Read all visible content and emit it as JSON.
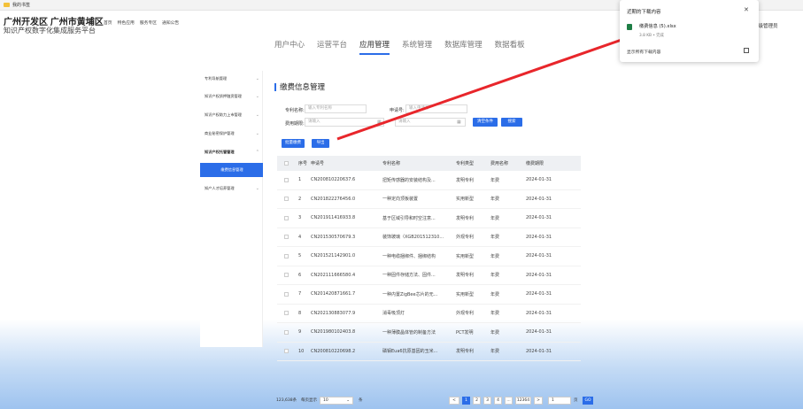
{
  "bookmarks": {
    "folder_label": "我的书签"
  },
  "header": {
    "title": "广州开发区 广州市黄埔区",
    "subtitle": "知识产权数字化集成服务平台",
    "nav": [
      "首页",
      "特色应用",
      "服务专区",
      "通知公告"
    ],
    "user": "超级管理员"
  },
  "tabs": [
    {
      "label": "用户中心",
      "active": false
    },
    {
      "label": "运营平台",
      "active": false
    },
    {
      "label": "应用管理",
      "active": true
    },
    {
      "label": "系统管理",
      "active": false
    },
    {
      "label": "数据库管理",
      "active": false
    },
    {
      "label": "数据看板",
      "active": false
    }
  ],
  "sidebar": {
    "items": [
      {
        "label": "专利导航管理"
      },
      {
        "label": "知识产权质押融资管理"
      },
      {
        "label": "知识产权助力上市管理"
      },
      {
        "label": "商业秘密保护管理"
      },
      {
        "label": "知识产权托管管理"
      },
      {
        "label": "缴费信息管理"
      },
      {
        "label": "知产人才培养管理"
      }
    ]
  },
  "page": {
    "title": "缴费信息管理",
    "filters": {
      "patent_name_label": "专利名称:",
      "patent_name_placeholder": "输入专利名称",
      "app_no_label": "申请号:",
      "app_no_placeholder": "输入申请号",
      "fee_date_label": "费用期限:",
      "fee_date_start_placeholder": "请输入",
      "fee_date_end_placeholder": "请输入",
      "clear_label": "清空条件",
      "search_label": "搜索"
    },
    "actions": {
      "add_label": "批量缴费",
      "export_label": "导出"
    }
  },
  "table": {
    "columns": [
      "序号",
      "申请号",
      "专利名称",
      "专利类型",
      "费用名称",
      "缴费期限"
    ],
    "rows": [
      [
        "1",
        "CN200810220637.6",
        "扭矩传感器的安装结构及...",
        "发明专利",
        "年费",
        "2024-01-31"
      ],
      [
        "2",
        "CN201822276456.0",
        "一种定向顶板装置",
        "实用新型",
        "年费",
        "2024-01-31"
      ],
      [
        "3",
        "CN201911416933.8",
        "基于区域引导和时空注意...",
        "发明专利",
        "年费",
        "2024-01-31"
      ],
      [
        "4",
        "CN201530570679.3",
        "装饰玻璃（XGB201512310...",
        "外观专利",
        "年费",
        "2024-01-31"
      ],
      [
        "5",
        "CN201521142901.0",
        "一种电缆捆绑件、捆绑结构",
        "实用新型",
        "年费",
        "2024-01-31"
      ],
      [
        "6",
        "CN202111666580.4",
        "一种固件存储方法、固件...",
        "发明专利",
        "年费",
        "2024-01-31"
      ],
      [
        "7",
        "CN201420871661.7",
        "一种内置ZigBee芯片的无...",
        "实用新型",
        "年费",
        "2024-01-31"
      ],
      [
        "8",
        "CN202130883077.9",
        "消毒吸顶灯",
        "外观专利",
        "年费",
        "2024-01-31"
      ],
      [
        "9",
        "CN201980102403.8",
        "一种薄膜晶体管的制备方法",
        "PCT发明",
        "年费",
        "2024-01-31"
      ],
      [
        "10",
        "CN200810220698.2",
        "磷钼Eua6抗原基因的玉米...",
        "发明专利",
        "年费",
        "2024-01-31"
      ]
    ]
  },
  "pagination": {
    "total": "123,638条",
    "per_page_label": "每页显示",
    "per_page": "10",
    "unit": "条",
    "prev": "<",
    "pages": [
      "1",
      "2",
      "3",
      "4",
      "...",
      "12364"
    ],
    "next": ">",
    "jump_value": "1",
    "page_unit": "页",
    "go": "GO"
  },
  "downloads": {
    "title": "近期的下载内容",
    "file_name": "缴费信息 (5).xlsx",
    "file_meta": "3.8 KB • 完成",
    "show_all": "显示所有下载内容"
  },
  "colors": {
    "accent": "#2b6de8",
    "arrow": "#e8262b",
    "excel": "#1e7e45"
  }
}
